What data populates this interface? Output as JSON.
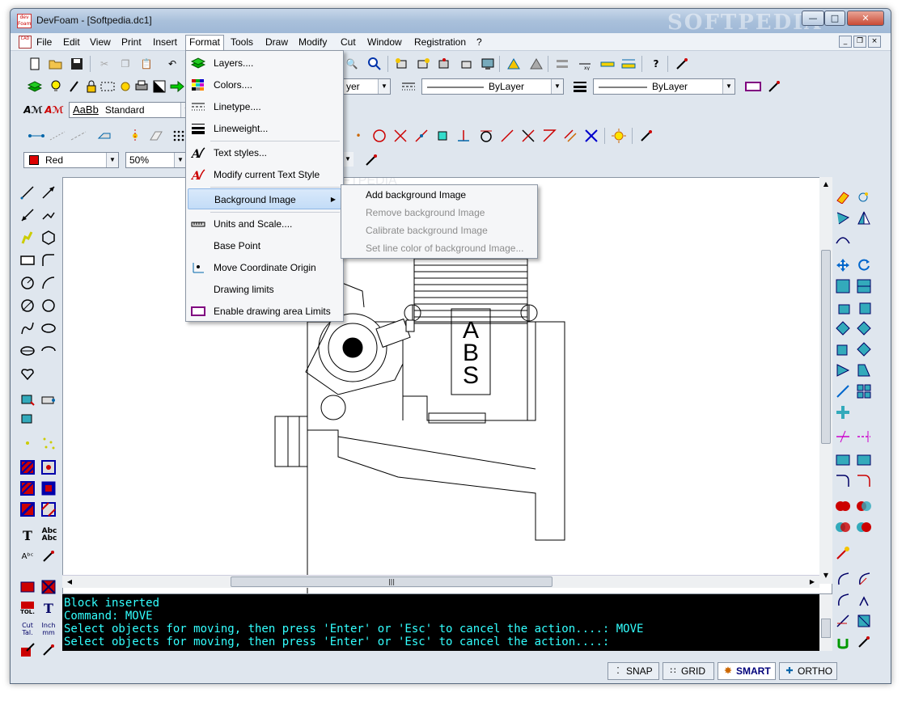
{
  "window": {
    "title": "DevFoam - [Softpedia.dc1]",
    "watermark": "SOFTPEDIA",
    "canvas_watermark": "SOFTPEDIA"
  },
  "menubar": {
    "items": [
      "File",
      "Edit",
      "View",
      "Print",
      "Insert",
      "Format",
      "Tools",
      "Draw",
      "Modify",
      "Cut",
      "Window",
      "Registration",
      "?"
    ],
    "active": "Format"
  },
  "toolbar": {
    "text_style_preview": "AaBb",
    "text_style": "Standard",
    "layer_value": "yer",
    "linetype_value": "ByLayer",
    "lineweight_value": "ByLayer",
    "color_value": "Red",
    "zoom_value": "50%"
  },
  "format_menu": {
    "items": [
      {
        "label": "Layers....",
        "icon": "layers-icon"
      },
      {
        "label": "Colors....",
        "icon": "colors-icon"
      },
      {
        "label": "Linetype....",
        "icon": "linetype-icon"
      },
      {
        "label": "Lineweight...",
        "icon": "lineweight-icon"
      },
      {
        "label": "Text styles...",
        "icon": "text-styles-icon"
      },
      {
        "label": "Modify current Text Style",
        "icon": "modify-text-style-icon"
      },
      {
        "label": "Background Image",
        "icon": "",
        "submenu": true
      },
      {
        "label": "Units and Scale....",
        "icon": "ruler-icon"
      },
      {
        "label": "Base Point",
        "icon": ""
      },
      {
        "label": "Move Coordinate Origin",
        "icon": "coordinate-origin-icon"
      },
      {
        "label": "Drawing limits",
        "icon": ""
      },
      {
        "label": "Enable drawing area Limits",
        "icon": "limits-rect-icon"
      }
    ]
  },
  "background_submenu": {
    "items": [
      {
        "label": "Add background Image",
        "enabled": true
      },
      {
        "label": "Remove background Image",
        "enabled": false
      },
      {
        "label": "Calibrate background Image",
        "enabled": false
      },
      {
        "label": "Set line color of background Image...",
        "enabled": false
      }
    ]
  },
  "drawing": {
    "label_a": "A",
    "label_b": "B",
    "label_s": "S"
  },
  "console": {
    "lines": [
      "Block inserted",
      "Command: MOVE",
      "Select objects for moving, then press 'Enter' or 'Esc' to cancel the action....: MOVE",
      "Select objects for moving, then press 'Enter' or 'Esc' to cancel the action....:"
    ]
  },
  "left_panel": {
    "tol_label": "TOL.",
    "cut_tal_label": "Cut Tal.",
    "inch_mm_label": "Inch mm",
    "text_tool_label": "T",
    "abc_label": "Abc Abc"
  },
  "statusbar": {
    "snap": "SNAP",
    "grid": "GRID",
    "smart": "SMART",
    "ortho": "ORTHO"
  },
  "colors": {
    "console_text": "#33ffff",
    "accent_red": "#dd0000",
    "highlight": "#c3dcf7"
  }
}
